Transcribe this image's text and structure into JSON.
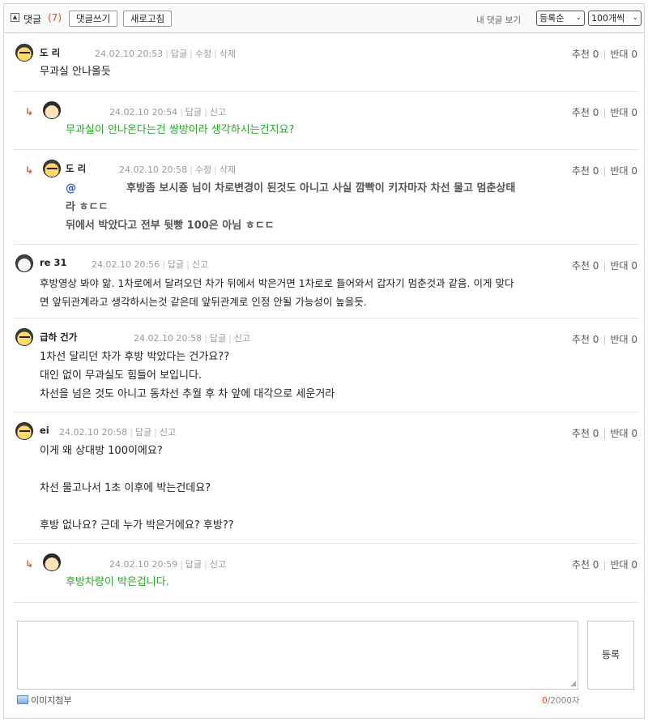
{
  "header": {
    "collapse_icon": "▲",
    "title": "댓글",
    "count": "(7)",
    "write_button": "댓글쓰기",
    "refresh_button": "새로고침",
    "my_comments_link": "내 댓글 보기",
    "sort_select": "등록순",
    "per_page_select": "100개씩"
  },
  "comments": [
    {
      "nick": "도 리",
      "meta": {
        "date": "24.02.10 20:53",
        "a1": "답글",
        "a2": "수정",
        "a3": "삭제"
      },
      "votes": {
        "up": "추천 0",
        "down": "반대 0"
      },
      "lines": [
        "무과실 안나올듯"
      ]
    },
    {
      "nick": "",
      "meta": {
        "date": "24.02.10 20:54",
        "a1": "답글",
        "a2": "신고"
      },
      "votes": {
        "up": "추천 0",
        "down": "반대 0"
      },
      "lines": [
        "무과실이 안나온다는건 쌍방이라 생각하시는건지요?"
      ]
    },
    {
      "nick": "도 리",
      "meta": {
        "date": "24.02.10 20:58",
        "a1": "수정",
        "a2": "삭제"
      },
      "votes": {
        "up": "추천 0",
        "down": "반대 0"
      },
      "mention": "@",
      "lines": [
        "후방좀 보시죵 님이 차로변경이 된것도 아니고 사실 깜빡이 키자마자 차선 물고 멈춘상태",
        "라 ㅎㄷㄷ",
        "뒤에서 박았다고 전부 뒷빵 100은 아님 ㅎㄷㄷ"
      ]
    },
    {
      "nick": "re 31",
      "meta": {
        "date": "24.02.10 20:56",
        "a1": "답글",
        "a2": "신고"
      },
      "votes": {
        "up": "추천 0",
        "down": "반대 0"
      },
      "lines": [
        "후방영상 봐야 앎. 1차로에서 달려오던 차가 뒤에서 박은거면 1차로로 들어와서 갑자기 멈춘것과 같음. 이게 맞다",
        "면 앞뒤관계라고 생각하시는것 같은데 앞뒤관계로 인정 안될 가능성이 높을듯."
      ]
    },
    {
      "nick": "급하 건가",
      "meta": {
        "date": "24.02.10 20:58",
        "a1": "답글",
        "a2": "신고"
      },
      "votes": {
        "up": "추천 0",
        "down": "반대 0"
      },
      "lines": [
        "1차선 달리던 차가 후방 박았다는 건가요??",
        "대인 없이 무과실도 힘들어 보입니다.",
        "차선을 넘은 것도 아니고 동차선 추월 후 차 앞에 대각으로 세운거라"
      ]
    },
    {
      "nick": "ei",
      "meta": {
        "date": "24.02.10 20:58",
        "a1": "답글",
        "a2": "신고"
      },
      "votes": {
        "up": "추천 0",
        "down": "반대 0"
      },
      "lines": [
        "이게 왜 상대방 100이에요?",
        "",
        "차선 물고나서 1초 이후에 박는건데요?",
        "",
        "후방 없나요? 근데 누가 박은거에요? 후방??"
      ]
    },
    {
      "nick": "",
      "meta": {
        "date": "24.02.10 20:59",
        "a1": "답글",
        "a2": "신고"
      },
      "votes": {
        "up": "추천 0",
        "down": "반대 0"
      },
      "lines": [
        "후방차량이 박은겁니다."
      ]
    }
  ],
  "reply_arrow": "↳",
  "editor": {
    "submit_button": "등록",
    "image_attach": "이미지첨부",
    "counter_current": "0",
    "counter_max": "/2000자"
  }
}
